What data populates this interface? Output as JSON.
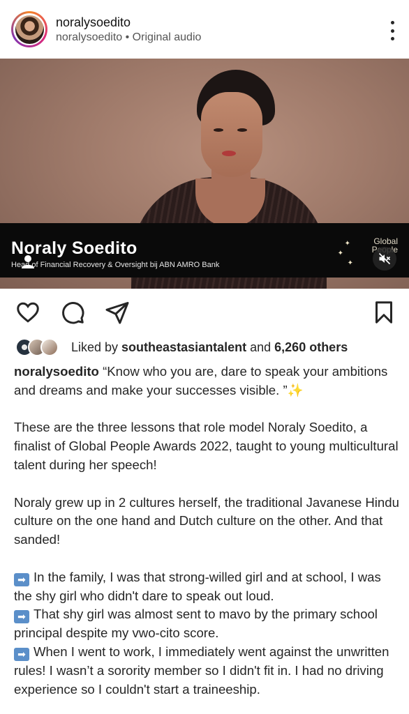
{
  "header": {
    "username": "noralysoedito",
    "subline": "noralysoedito • Original audio"
  },
  "media": {
    "name_overlay": "Noraly Soedito",
    "role_overlay": "Head of Financial Recovery & Oversight bij ABN AMRO Bank",
    "logo_line1": "Global",
    "logo_line2": "People"
  },
  "likes": {
    "prefix": "Liked by ",
    "user": "southeastasiantalent",
    "middle": " and ",
    "count": "6,260 others"
  },
  "caption": {
    "username": "noralysoedito",
    "first": " “Know who you are, dare to speak your ambitions and dreams and make your successes visible. ”",
    "p2": "These are the three lessons that role model Noraly Soedito, a finalist of Global People Awards 2022, taught to young multicultural talent during her speech!",
    "p3": "Noraly grew up in 2 cultures herself, the traditional Javanese Hindu culture on the one hand and Dutch culture on the other. And that sanded!",
    "b1": "In the family, I was that strong-willed girl and at school, I was the shy girl who didn't dare to speak out loud.",
    "b2": "That shy girl was almost sent to mavo by the primary school principal despite my vwo-cito score.",
    "b3": "When I went to work, I immediately went against the unwritten rules! I wasn’t a sorority member so I didn't fit in. I had no driving experience so I couldn't start a traineeship."
  },
  "icons": {
    "arrow_glyph": "➡",
    "sparkles_glyph": "✨"
  },
  "colors": {
    "story_ring": "#dd2a7b",
    "arrow_badge": "#5b8fc9"
  }
}
